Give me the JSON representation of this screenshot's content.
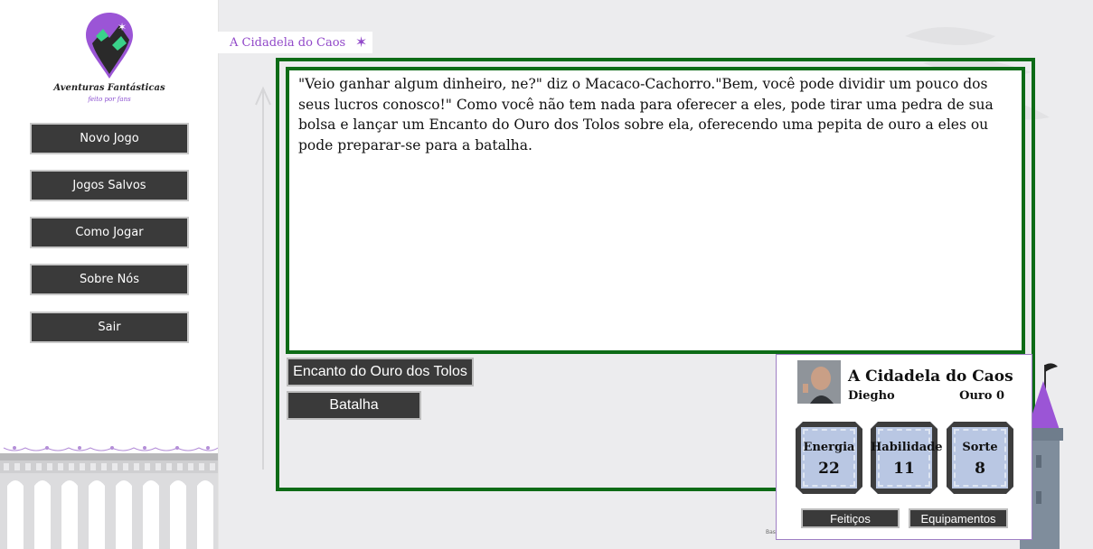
{
  "sidebar": {
    "logo": {
      "title": "Aventuras Fantásticas",
      "subtitle": "feito por fans"
    },
    "menu": [
      {
        "label": "Novo Jogo"
      },
      {
        "label": "Jogos Salvos"
      },
      {
        "label": "Como Jogar"
      },
      {
        "label": "Sobre Nós"
      },
      {
        "label": "Sair"
      }
    ]
  },
  "book_tab": {
    "title": "A Cidadela do Caos",
    "icon": "sparkle-icon"
  },
  "story": {
    "text": "\"Veio ganhar algum dinheiro, ne?\" diz o Macaco-Cachorro.\"Bem, você pode dividir um pouco dos seus lucros conosco!\" Como você não tem nada para oferecer a eles, pode tirar uma pedra de sua bolsa e lançar um Encanto do Ouro dos Tolos sobre ela, oferecendo uma pepita de ouro a eles ou pode preparar-se para a batalha."
  },
  "choices": [
    {
      "label": "Encanto do Ouro dos Tolos"
    },
    {
      "label": "Batalha"
    }
  ],
  "character": {
    "book_title": "A Cidadela do Caos",
    "player_name": "Diegho",
    "gold": "Ouro 0",
    "stats": [
      {
        "label": "Energia",
        "value": "22"
      },
      {
        "label": "Habilidade",
        "value": "11"
      },
      {
        "label": "Sorte",
        "value": "8"
      }
    ],
    "buttons": {
      "spells": "Feitiços",
      "equipment": "Equipamentos"
    }
  },
  "footer_text": "Bas",
  "colors": {
    "frame_green": "#0d6b16",
    "button_dark": "#3a3a3a",
    "accent_purple": "#9148c9",
    "stat_fill": "#b9c7e3"
  }
}
